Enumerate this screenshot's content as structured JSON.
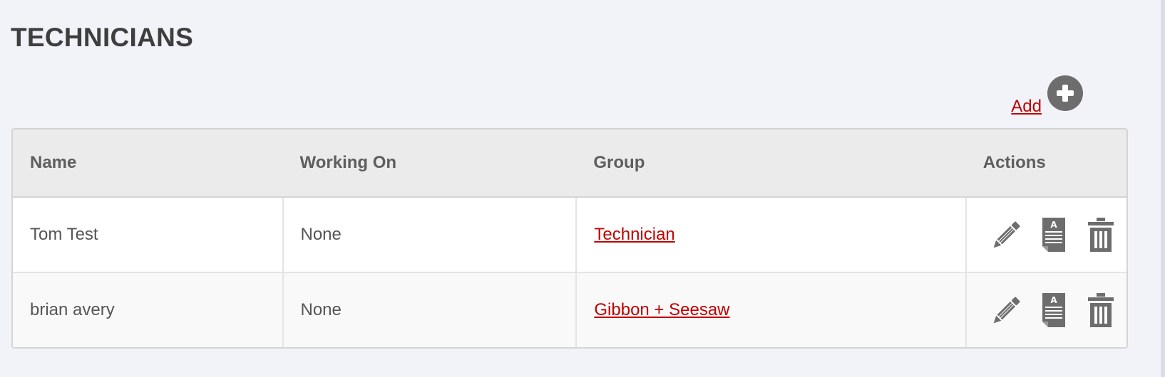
{
  "page": {
    "title": "TECHNICIANS"
  },
  "toolbar": {
    "add_label": "Add",
    "add_icon": "plus-circle-icon"
  },
  "table": {
    "columns": [
      "Name",
      "Working On",
      "Group",
      "Actions"
    ],
    "rows": [
      {
        "name": "Tom Test",
        "working_on": "None",
        "group": "Technician"
      },
      {
        "name": "brian avery",
        "working_on": "None",
        "group": "Gibbon + Seesaw"
      }
    ],
    "action_icons": [
      "pencil-icon",
      "document-icon",
      "trash-icon"
    ]
  },
  "colors": {
    "link": "#c00000",
    "icon": "#6d6d6d",
    "header_bg": "#ebebeb",
    "page_bg": "#f1f3f9"
  }
}
